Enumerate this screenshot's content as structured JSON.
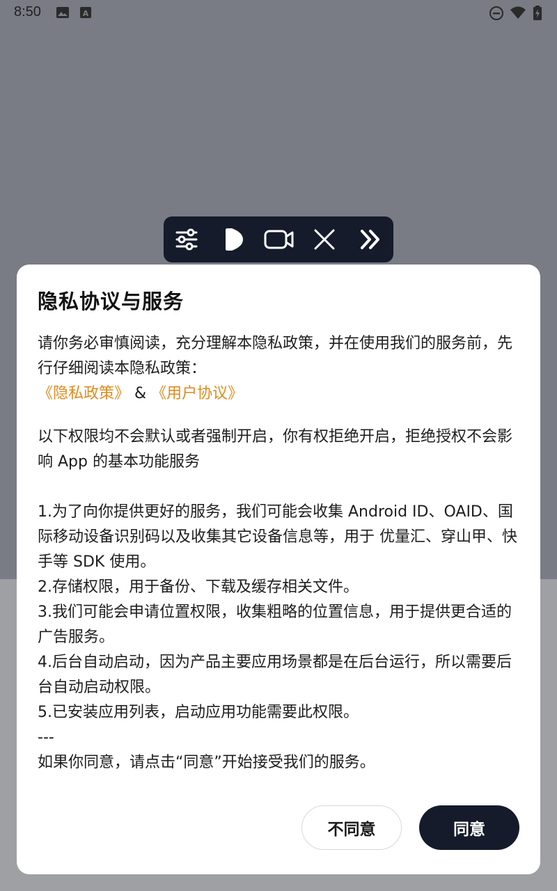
{
  "status_bar": {
    "time": "8:50",
    "icons": [
      "image-icon",
      "font-icon",
      "do-not-disturb-icon",
      "wifi-icon",
      "battery-charging-icon"
    ]
  },
  "toolbar": {
    "icons": [
      "sliders-icon",
      "play-icon",
      "video-camera-icon",
      "close-icon",
      "fast-forward-icon"
    ]
  },
  "dialog": {
    "title": "隐私协议与服务",
    "intro": "请你务必审慎阅读，充分理解本隐私政策，并在使用我们的服务前，先行仔细阅读本隐私政策：",
    "privacy_link": "《隐私政策》",
    "amp": "&",
    "user_link": "《用户协议》",
    "permission_note": "以下权限均不会默认或者强制开启，你有权拒绝开启，拒绝授权不会影响 App 的基本功能服务",
    "items": [
      "1.为了向你提供更好的服务，我们可能会收集 Android ID、OAID、国际移动设备识别码以及收集其它设备信息等，用于 优量汇、穿山甲、快手等 SDK 使用。",
      "2.存储权限，用于备份、下载及缓存相关文件。",
      "3.我们可能会申请位置权限，收集粗略的位置信息，用于提供更合适的广告服务。",
      "4.后台自动启动，因为产品主要应用场景都是在后台运行，所以需要后台自动启动权限。",
      "5.已安装应用列表，启动应用功能需要此权限。"
    ],
    "separator": "---",
    "closing": "如果你同意，请点击“同意”开始接受我们的服务。",
    "disagree_label": "不同意",
    "agree_label": "同意"
  }
}
